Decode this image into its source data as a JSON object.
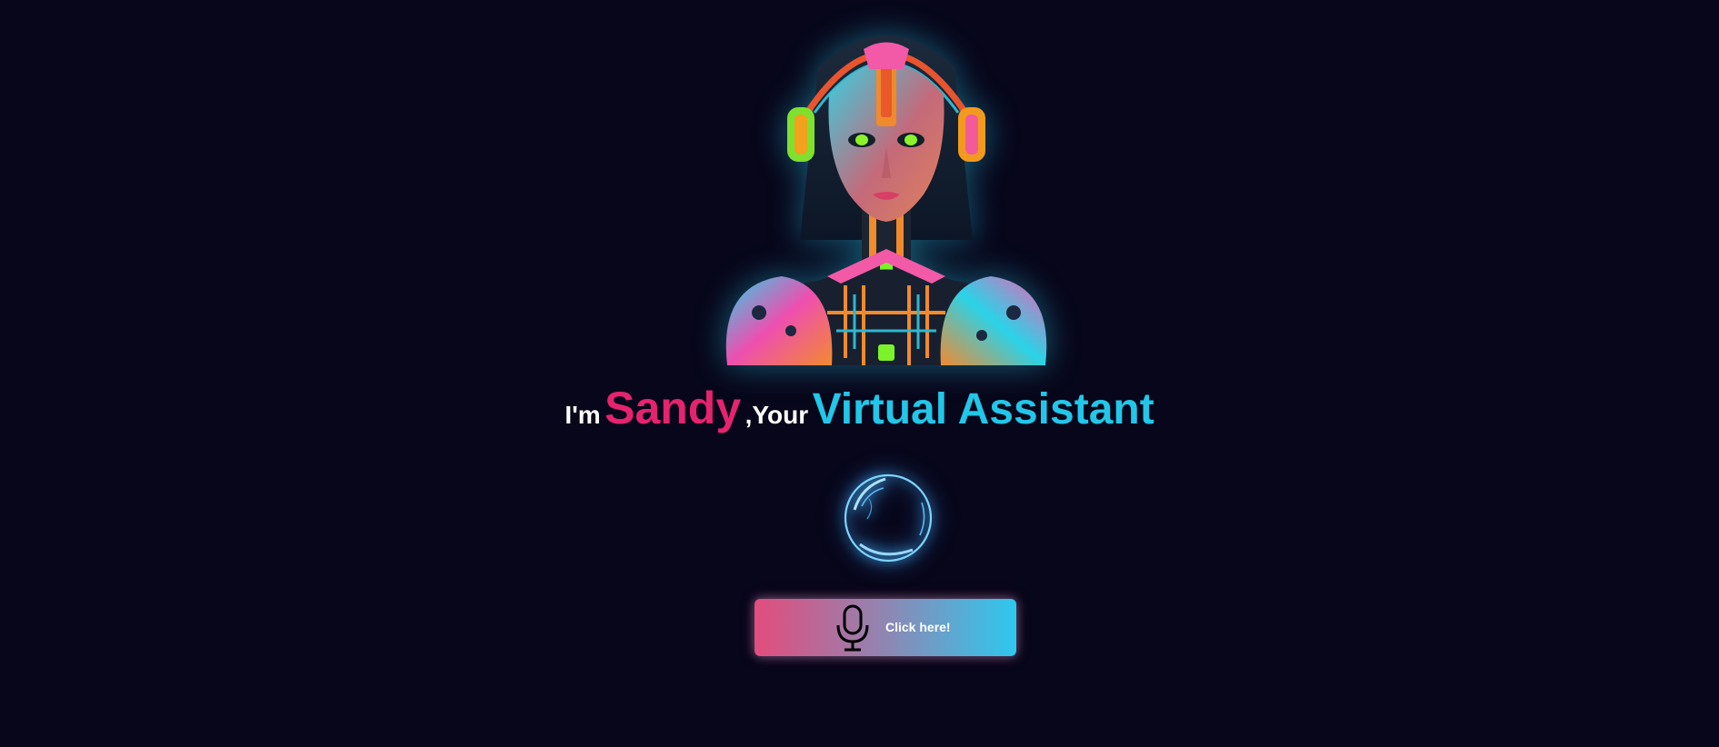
{
  "hero": {
    "avatar_icon": "robot-woman-avatar",
    "glow_color": "#28c8e6"
  },
  "headline": {
    "prefix": "I'm",
    "name": "Sandy",
    "connector": ",Your",
    "role": "Virtual Assistant",
    "colors": {
      "name": "#e5236e",
      "role": "#22c6e8",
      "plain": "#ffffff"
    }
  },
  "voice_orb": {
    "icon": "voice-orb-icon",
    "color": "#45b8ff"
  },
  "talk_button": {
    "label": "Click here!",
    "icon": "microphone-icon",
    "gradient": [
      "#e24d7c",
      "#2ec8ee"
    ]
  },
  "background_color": "#07061a"
}
